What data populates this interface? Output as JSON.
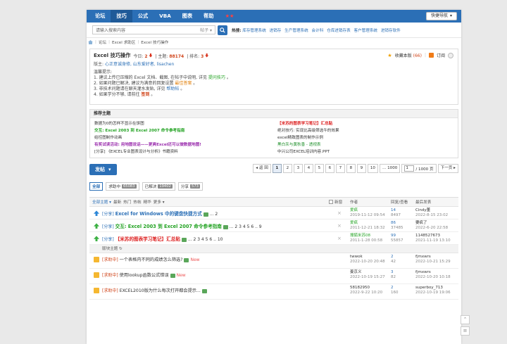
{
  "nav": {
    "items": [
      "论坛",
      "技巧",
      "公式",
      "VBA",
      "图表",
      "帮助",
      "★★"
    ],
    "quick_nav": "快捷导航"
  },
  "search": {
    "placeholder": "请输入搜索内容",
    "scope": "帖子",
    "hot_label": "热搜:",
    "hot_words": [
      "库存管理系统",
      "进销存",
      "生产管理系统",
      "会计科",
      "仓库进销存表",
      "客户管理系统",
      "进销存软件"
    ]
  },
  "breadcrumb": [
    "论坛",
    "Excel 求助区",
    "Excel 技巧操作"
  ],
  "forum": {
    "name": "Excel 技巧操作",
    "today_label": "今日: ",
    "today": "2",
    "topics_label": "主题: ",
    "topics": "88174",
    "rank_label": "排名: ",
    "rank": "3",
    "mods_label": "版主: ",
    "mods": "心正意诚身修, 山东爱好者, lisachen",
    "tip_title": "温馨提示:",
    "tips": [
      {
        "pre": "1. 建议上传已压缩的 Excel 文档、截图, 在帖子中说明, 详见 ",
        "link": "提问技巧",
        "post": " 。",
        "cls": "g"
      },
      {
        "pre": "2. 如果问题已解决, 建议为满意的回复设置 ",
        "link": "最佳答案",
        "post": " 。",
        "cls": "o"
      },
      {
        "pre": "3. 非技术问题请在聊天灌水发贴, 详见 ",
        "link": "帮助帖",
        "post": " 。",
        "cls": "b"
      },
      {
        "pre": "4. 如果学分不够, 请前往 ",
        "link": "签到",
        "post": " 。",
        "cls": "r"
      }
    ],
    "favorite_label": "收藏本版",
    "favorite_count": "(66)",
    "subscribe_label": "订阅"
  },
  "recommended": {
    "title": "推荐主题",
    "left": [
      {
        "text": "数据为0的怎样不显示在饼图",
        "cls": ""
      },
      {
        "text": "交互: Excel 2003 到 Excel 2007 命令参考指南",
        "cls": "c-green"
      },
      {
        "text": "给控图制作动画",
        "cls": ""
      },
      {
        "text": "有奖试读活动: 用地图说话——更爽Excel还可以做数据地图!",
        "cls": "c-purple"
      },
      {
        "text": "[分享] 《EXCEL专业图表设计与分析》书籍资料",
        "cls": ""
      }
    ],
    "right": [
      {
        "text": "【米苏的图表学习笔记】汇总贴",
        "cls": "c-red"
      },
      {
        "text": "绝对技巧: 实现比高级筛选牛的效果",
        "cls": ""
      },
      {
        "text": "excel精致图表的制作示例",
        "cls": ""
      },
      {
        "text": "黑白灰与黄秋香 - 透视表",
        "cls": "c-dgreen"
      },
      {
        "text": "中兴公司EXCEL培训内容.PPT",
        "cls": ""
      }
    ]
  },
  "pager": {
    "post_button": "发帖",
    "back": "◂ 返 回",
    "pages": [
      "1",
      "2",
      "3",
      "4",
      "5",
      "6",
      "7",
      "8",
      "9",
      "10",
      "... 1000"
    ],
    "current_page": "1",
    "goto_value": "1",
    "total": "/ 1000 页",
    "next": "下一页 ▸"
  },
  "tabs": [
    {
      "label": "全部",
      "count": ""
    },
    {
      "label": "求助中",
      "count": "65083"
    },
    {
      "label": "已解决",
      "count": "19402"
    },
    {
      "label": "分享",
      "count": "573"
    }
  ],
  "table": {
    "filters": [
      "全部主题 ▾",
      "最新",
      "热门",
      "热帖",
      "精华",
      "更多 ▾"
    ],
    "new_label": "新窗",
    "col_author": "作者",
    "col_replies": "回复/查看",
    "col_last": "最后发表",
    "section_label": "版块主题",
    "sticky": [
      {
        "tag": "[分享]",
        "title": "Excel for Windows 中的键盘快捷方式",
        "title_cls": "b",
        "extra": "... 2",
        "author": "爱疯",
        "author_date": "2019-11-12 09:54",
        "replies": "14",
        "views": "8497",
        "last_user": "Cindy董",
        "last_date": "2022-8-15 23:02",
        "icon": "up"
      },
      {
        "tag": "[分享]",
        "title": "交互: Excel 2003 到 Excel 2007 命令参考指南",
        "title_cls": "g",
        "extra": "... 2 3 4 5 6 .. 9",
        "author": "爱疯",
        "author_date": "2011-12-21 18:32",
        "replies": "86",
        "views": "37485",
        "last_user": "要疯了",
        "last_date": "2022-6-20 22:58",
        "icon": "upg"
      },
      {
        "tag": "[分享]",
        "title": "【米苏的图表学习笔记】汇总贴",
        "title_cls": "r",
        "extra": "... 2 3 4 5 6 .. 10",
        "author": "搜狐米苏08",
        "author_date": "2011-1-28 00:58",
        "replies": "99",
        "views": "55857",
        "last_user": "1148527673",
        "last_date": "2021-11-19 13:10",
        "icon": "upg"
      }
    ],
    "threads": [
      {
        "tag": "[求助中]",
        "title": "一个表格内不同的成绩怎么筛选?",
        "new": "New",
        "author": "twwok",
        "author_date": "2022-10-20 20:48",
        "replies": "2",
        "views": "42",
        "last_user": "fjmxwrs",
        "last_date": "2022-10-21 15:29"
      },
      {
        "tag": "[求助中]",
        "title": "使用lookup函数公式错误",
        "new": "New",
        "author": "姜京义",
        "author_date": "2022-10-19 15:27",
        "replies": "3",
        "views": "82",
        "last_user": "fjmxwrs",
        "last_date": "2022-10-20 10:18"
      },
      {
        "tag": "[求助中]",
        "title": "EXCEL2010版为什么每次打开都会提示...",
        "new": "",
        "author": "58182950",
        "author_date": "2022-9-22 10:20",
        "replies": "2",
        "views": "160",
        "last_user": "superboy_713",
        "last_date": "2022-10-19 19:06"
      }
    ]
  }
}
